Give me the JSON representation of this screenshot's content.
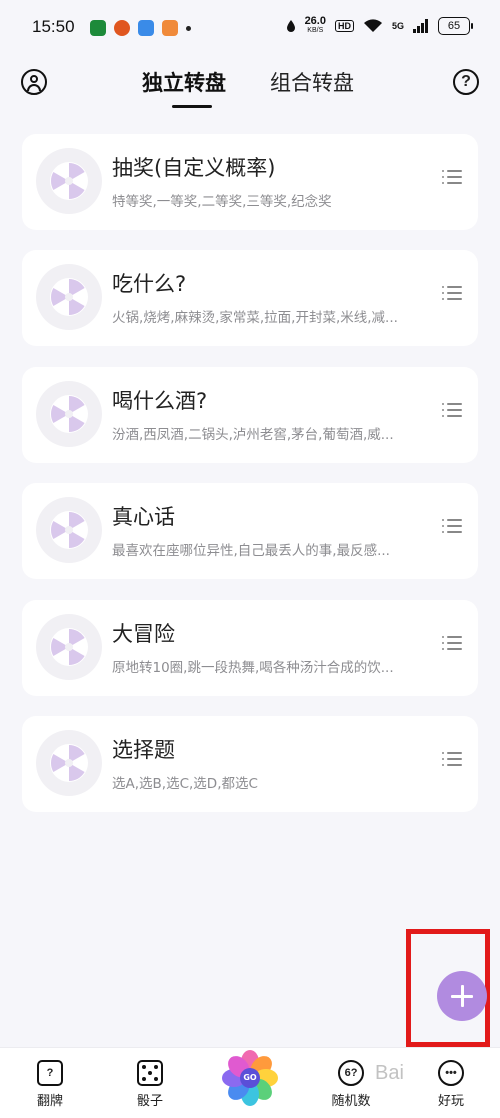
{
  "status_bar": {
    "time": "15:50",
    "net_speed": "26.0",
    "net_unit": "KB/S",
    "hd": "HD",
    "signal": "5G",
    "battery": "65"
  },
  "header": {
    "tab_active": "独立转盘",
    "tab_inactive": "组合转盘",
    "help_glyph": "?"
  },
  "cards": [
    {
      "title": "抽奖(自定义概率)",
      "subtitle": "特等奖,一等奖,二等奖,三等奖,纪念奖"
    },
    {
      "title": "吃什么?",
      "subtitle": "火锅,烧烤,麻辣烫,家常菜,拉面,开封菜,米线,减..."
    },
    {
      "title": "喝什么酒?",
      "subtitle": "汾酒,西凤酒,二锅头,泸州老窖,茅台,葡萄酒,威..."
    },
    {
      "title": "真心话",
      "subtitle": "最喜欢在座哪位异性,自己最丢人的事,最反感..."
    },
    {
      "title": "大冒险",
      "subtitle": "原地转10圈,跳一段热舞,喝各种汤汁合成的饮..."
    },
    {
      "title": "选择题",
      "subtitle": "选A,选B,选C,选D,都选C"
    }
  ],
  "fab": {
    "icon": "plus-icon",
    "color": "#b18be0"
  },
  "highlight_color": "#e21a1a",
  "bottom_nav": {
    "flip_icon_text": "?",
    "flip": "翻牌",
    "dice": "骰子",
    "go": "GO",
    "random_icon_text": "6?",
    "random": "随机数",
    "fun": "好玩"
  },
  "watermark": "Bai"
}
